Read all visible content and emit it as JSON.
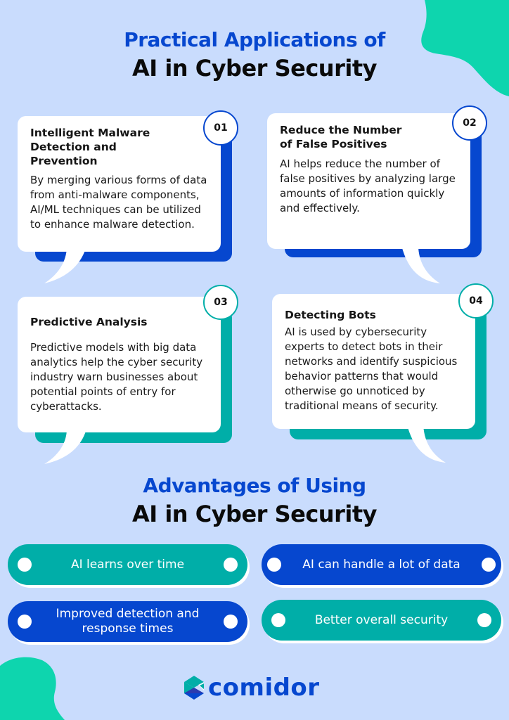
{
  "colors": {
    "background": "#c9dcfd",
    "blue": "#0647cf",
    "teal": "#00aea8",
    "blob": "#0ed5ae",
    "white": "#ffffff"
  },
  "section1": {
    "title_line1": "Practical Applications of",
    "title_line2": "AI in Cyber Security"
  },
  "cards": [
    {
      "number": "01",
      "title": "Intelligent Malware Detection and Prevention",
      "body": "By merging various forms of data from anti-malware components, AI/ML techniques can be utilized to enhance malware detection.",
      "accent": "blue"
    },
    {
      "number": "02",
      "title": "Reduce the Number of False Positives",
      "body": "AI helps reduce the number of false positives by analyzing large amounts of information quickly and effectively.",
      "accent": "blue"
    },
    {
      "number": "03",
      "title": "Predictive Analysis",
      "body": "Predictive models with big data analytics help the cyber security industry warn businesses about potential points of entry for cyberattacks.",
      "accent": "teal"
    },
    {
      "number": "04",
      "title": "Detecting Bots",
      "body": "AI is used by cybersecurity experts to detect bots in their networks and identify suspicious behavior patterns that would otherwise go unnoticed by traditional means of security.",
      "accent": "teal"
    }
  ],
  "section2": {
    "title_line1": "Advantages of Using",
    "title_line2": "AI in Cyber Security"
  },
  "advantages": [
    {
      "label": "AI learns over time",
      "color": "teal"
    },
    {
      "label": "AI can handle a lot of data",
      "color": "blue"
    },
    {
      "label": "Improved detection and response times",
      "color": "blue"
    },
    {
      "label": "Better overall security",
      "color": "teal"
    }
  ],
  "logo": {
    "text": "comidor",
    "icon": "comidor-hexagon-logo-icon"
  }
}
